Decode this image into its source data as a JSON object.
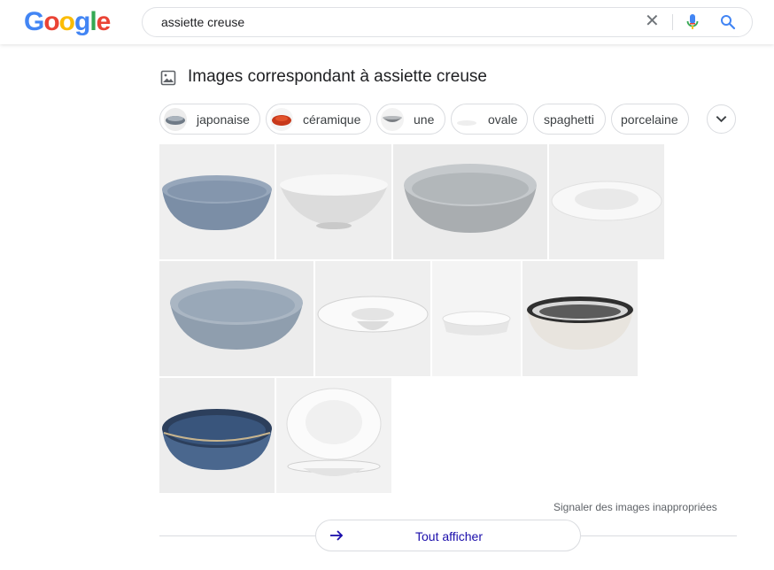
{
  "header": {
    "logo_letters": [
      "G",
      "o",
      "o",
      "g",
      "l",
      "e"
    ],
    "logo_colors": [
      "#4285f4",
      "#ea4335",
      "#fbbc05",
      "#4285f4",
      "#34a853",
      "#ea4335"
    ],
    "query": "assiette creuse",
    "clear_icon": "close-icon",
    "voice_icon": "microphone-icon",
    "search_icon": "search-icon"
  },
  "section": {
    "icon": "image-icon",
    "title": "Images correspondant à assiette creuse"
  },
  "chips": [
    {
      "label": "japonaise"
    },
    {
      "label": "céramique"
    },
    {
      "label": "une"
    },
    {
      "label": "ovale"
    },
    {
      "label": "spaghetti"
    },
    {
      "label": "porcelaine"
    }
  ],
  "images": [
    {
      "alt": "bol bleu gris"
    },
    {
      "alt": "bol blanc"
    },
    {
      "alt": "saladier gris"
    },
    {
      "alt": "assiette creuse blanche"
    },
    {
      "alt": "assiette creuse bleu gris"
    },
    {
      "alt": "assiette à large bord"
    },
    {
      "alt": "assiette blanche basse"
    },
    {
      "alt": "bol à rayures noires"
    },
    {
      "alt": "bol bleu émaillé"
    },
    {
      "alt": "assiettes blanches empilées"
    }
  ],
  "footer": {
    "report_link": "Signaler des images inappropriées",
    "show_all": "Tout afficher",
    "arrow_icon": "arrow-right-icon"
  }
}
